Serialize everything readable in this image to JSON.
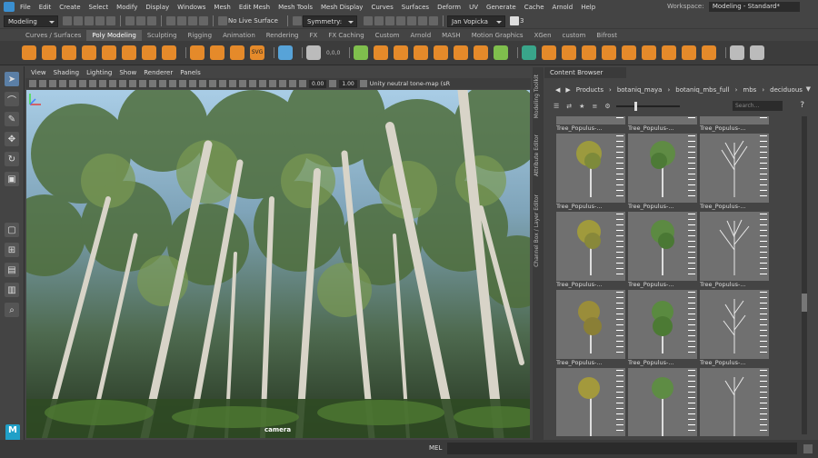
{
  "menubar": {
    "items": [
      "File",
      "Edit",
      "Create",
      "Select",
      "Modify",
      "Display",
      "Windows",
      "Mesh",
      "Edit Mesh",
      "Mesh Tools",
      "Mesh Display",
      "Curves",
      "Surfaces",
      "Deform",
      "UV",
      "Generate",
      "Cache",
      "Arnold",
      "Help"
    ],
    "workspace_label": "Workspace:",
    "workspace_value": "Modeling - Standard*"
  },
  "statusline": {
    "menuset": "Modeling",
    "live_surface": "No Live Surface",
    "symmetry": "Symmetry: Off",
    "user": "Jan Vopicka",
    "notifications": "3"
  },
  "shelf_tabs": {
    "items": [
      "Curves / Surfaces",
      "Poly Modeling",
      "Sculpting",
      "Rigging",
      "Animation",
      "Rendering",
      "FX",
      "FX Caching",
      "Custom",
      "Arnold",
      "MASH",
      "Motion Graphics",
      "XGen",
      "custom",
      "Bifrost"
    ],
    "active": "Poly Modeling"
  },
  "shelf": {
    "svg_label": "SVG",
    "coords": "0,0,0"
  },
  "viewport": {
    "menu": [
      "View",
      "Shading",
      "Lighting",
      "Show",
      "Renderer",
      "Panels"
    ],
    "exposure": "0.00",
    "gamma": "1.00",
    "colorspace": "Unity neutral tone-map (sRGB",
    "camera_label": "camera"
  },
  "side_tabs": [
    "Modeling Toolkit",
    "Attribute Editor",
    "Channel Box / Layer Editor"
  ],
  "content_browser": {
    "title": "Content Browser",
    "breadcrumb": [
      "Products",
      "botaniq_maya",
      "botaniq_mbs_full",
      "mbs",
      "deciduous"
    ],
    "search_placeholder": "Search...",
    "thumb_label": "Tree_Populus-..."
  },
  "toolbox": {
    "logo": "M"
  },
  "bottom": {
    "mel_label": "MEL"
  },
  "colors": {
    "accent": "#5b7fa6",
    "shelf_orange": "#e58a2a",
    "maya_blue": "#20a0c8"
  }
}
